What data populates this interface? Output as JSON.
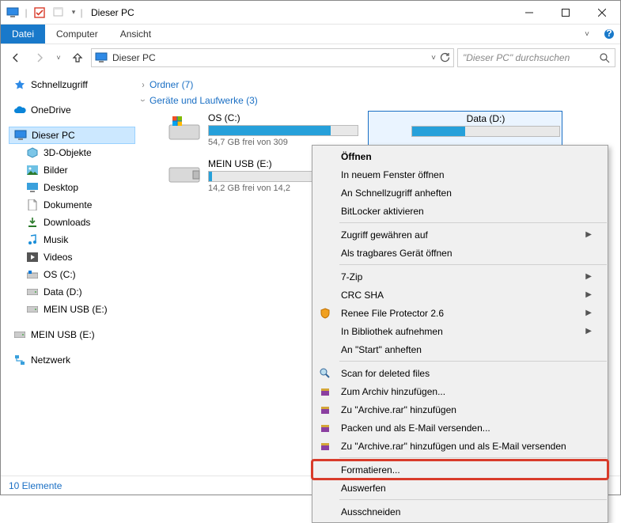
{
  "title": "Dieser PC",
  "ribbon": {
    "file": "Datei",
    "computer": "Computer",
    "view": "Ansicht"
  },
  "addressbar": {
    "crumb": "Dieser PC"
  },
  "search": {
    "placeholder": "\"Dieser PC\" durchsuchen"
  },
  "sidebar": {
    "quick": "Schnellzugriff",
    "onedrive": "OneDrive",
    "thispc": "Dieser PC",
    "objs": "3D-Objekte",
    "pictures": "Bilder",
    "desktop": "Desktop",
    "documents": "Dokumente",
    "downloads": "Downloads",
    "music": "Musik",
    "videos": "Videos",
    "osc": "OS (C:)",
    "datad": "Data (D:)",
    "usb_e": "MEIN USB (E:)",
    "usb_e2": "MEIN USB (E:)",
    "network": "Netzwerk"
  },
  "groups": {
    "folders": "Ordner (7)",
    "drives": "Geräte und Laufwerke (3)"
  },
  "drives": {
    "os": {
      "name": "OS (C:)",
      "free": "54,7 GB frei von 309",
      "fill": "82%"
    },
    "data": {
      "name": "Data (D:)",
      "free": "",
      "fill": "36%"
    },
    "usb": {
      "name": "MEIN USB (E:)",
      "free": "14,2 GB frei von 14,2",
      "fill": "2%"
    }
  },
  "ctx": {
    "open": "Öffnen",
    "newwin": "In neuem Fenster öffnen",
    "pinquick": "An Schnellzugriff anheften",
    "bitlocker": "BitLocker aktivieren",
    "grant": "Zugriff gewähren auf",
    "portable": "Als tragbares Gerät öffnen",
    "sevenzip": "7-Zip",
    "crcsha": "CRC SHA",
    "renee": "Renee File Protector 2.6",
    "library": "In Bibliothek aufnehmen",
    "pinstart": "An \"Start\" anheften",
    "scandel": "Scan for deleted files",
    "toarchive": "Zum Archiv hinzufügen...",
    "torar": "Zu \"Archive.rar\" hinzufügen",
    "packmail": "Packen und als E-Mail versenden...",
    "torarmail": "Zu \"Archive.rar\" hinzufügen und als E-Mail versenden",
    "format": "Formatieren...",
    "eject": "Auswerfen",
    "cut": "Ausschneiden"
  },
  "status": {
    "count": "10 Elemente"
  }
}
